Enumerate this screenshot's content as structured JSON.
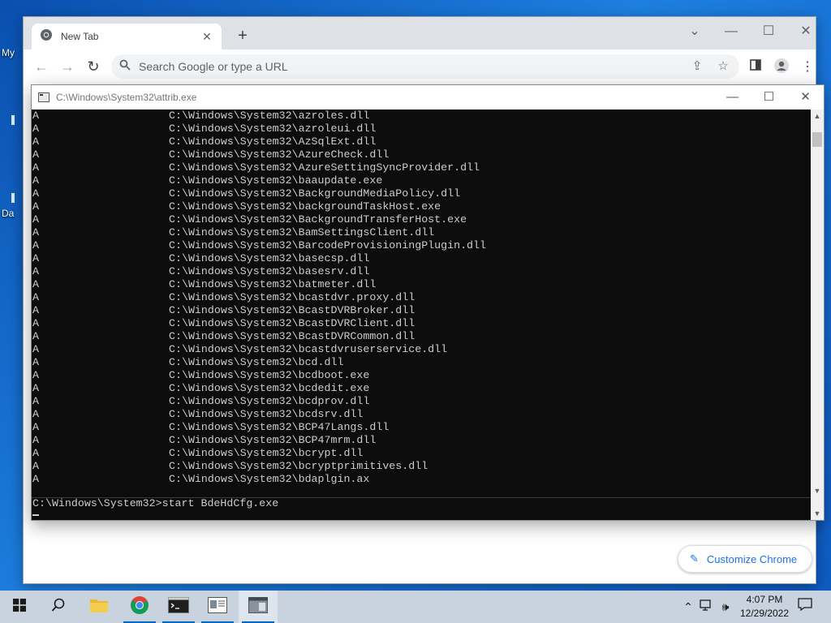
{
  "desktop": {
    "icons": [
      {
        "label": "My"
      },
      {
        "label": "Da"
      }
    ]
  },
  "chrome": {
    "tab_title": "New Tab",
    "tab_close": "✕",
    "new_tab": "+",
    "omnibox_placeholder": "Search Google or type a URL",
    "customize_label": "Customize Chrome"
  },
  "console": {
    "title": "C:\\Windows\\System32\\attrib.exe",
    "lines": [
      {
        "attr": "A",
        "path": "C:\\Windows\\System32\\azroles.dll"
      },
      {
        "attr": "A",
        "path": "C:\\Windows\\System32\\azroleui.dll"
      },
      {
        "attr": "A",
        "path": "C:\\Windows\\System32\\AzSqlExt.dll"
      },
      {
        "attr": "A",
        "path": "C:\\Windows\\System32\\AzureCheck.dll"
      },
      {
        "attr": "A",
        "path": "C:\\Windows\\System32\\AzureSettingSyncProvider.dll"
      },
      {
        "attr": "A",
        "path": "C:\\Windows\\System32\\baaupdate.exe"
      },
      {
        "attr": "A",
        "path": "C:\\Windows\\System32\\BackgroundMediaPolicy.dll"
      },
      {
        "attr": "A",
        "path": "C:\\Windows\\System32\\backgroundTaskHost.exe"
      },
      {
        "attr": "A",
        "path": "C:\\Windows\\System32\\BackgroundTransferHost.exe"
      },
      {
        "attr": "A",
        "path": "C:\\Windows\\System32\\BamSettingsClient.dll"
      },
      {
        "attr": "A",
        "path": "C:\\Windows\\System32\\BarcodeProvisioningPlugin.dll"
      },
      {
        "attr": "A",
        "path": "C:\\Windows\\System32\\basecsp.dll"
      },
      {
        "attr": "A",
        "path": "C:\\Windows\\System32\\basesrv.dll"
      },
      {
        "attr": "A",
        "path": "C:\\Windows\\System32\\batmeter.dll"
      },
      {
        "attr": "A",
        "path": "C:\\Windows\\System32\\bcastdvr.proxy.dll"
      },
      {
        "attr": "A",
        "path": "C:\\Windows\\System32\\BcastDVRBroker.dll"
      },
      {
        "attr": "A",
        "path": "C:\\Windows\\System32\\BcastDVRClient.dll"
      },
      {
        "attr": "A",
        "path": "C:\\Windows\\System32\\BcastDVRCommon.dll"
      },
      {
        "attr": "A",
        "path": "C:\\Windows\\System32\\bcastdvruserservice.dll"
      },
      {
        "attr": "A",
        "path": "C:\\Windows\\System32\\bcd.dll"
      },
      {
        "attr": "A",
        "path": "C:\\Windows\\System32\\bcdboot.exe"
      },
      {
        "attr": "A",
        "path": "C:\\Windows\\System32\\bcdedit.exe"
      },
      {
        "attr": "A",
        "path": "C:\\Windows\\System32\\bcdprov.dll"
      },
      {
        "attr": "A",
        "path": "C:\\Windows\\System32\\bcdsrv.dll"
      },
      {
        "attr": "A",
        "path": "C:\\Windows\\System32\\BCP47Langs.dll"
      },
      {
        "attr": "A",
        "path": "C:\\Windows\\System32\\BCP47mrm.dll"
      },
      {
        "attr": "A",
        "path": "C:\\Windows\\System32\\bcrypt.dll"
      },
      {
        "attr": "A",
        "path": "C:\\Windows\\System32\\bcryptprimitives.dll"
      },
      {
        "attr": "A",
        "path": "C:\\Windows\\System32\\bdaplgin.ax"
      }
    ],
    "prompt": "C:\\Windows\\System32>start BdeHdCfg.exe"
  },
  "taskbar": {
    "time": "4:07 PM",
    "date": "12/29/2022"
  },
  "colors": {
    "desktop": "#1a6fd0",
    "console_bg": "#0c0c0c",
    "console_text": "#cccccc",
    "accent": "#1a73e8"
  }
}
